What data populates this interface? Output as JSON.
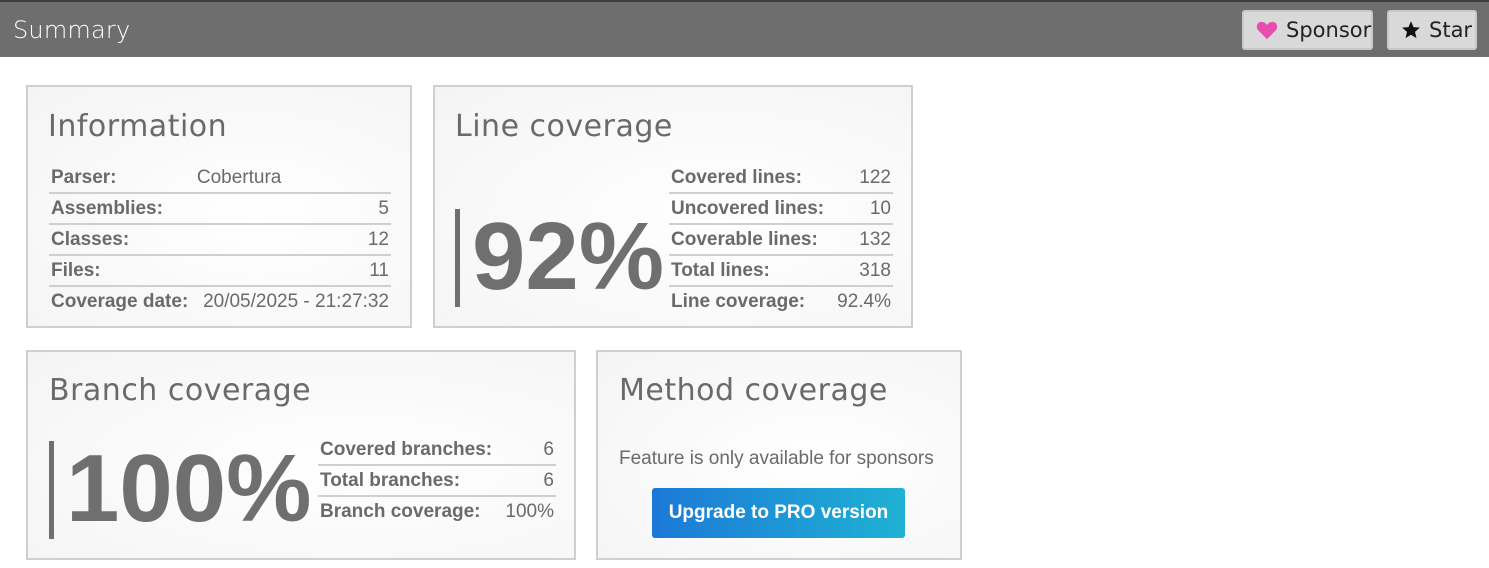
{
  "header": {
    "title": "Summary",
    "sponsor_label": "Sponsor",
    "star_label": "Star",
    "colors": {
      "bar": "#6e6e6e",
      "heart": "#e84eb0"
    }
  },
  "information": {
    "title": "Information",
    "rows": [
      {
        "label": "Parser:",
        "value": "Cobertura"
      },
      {
        "label": "Assemblies:",
        "value": "5"
      },
      {
        "label": "Classes:",
        "value": "12"
      },
      {
        "label": "Files:",
        "value": "11"
      },
      {
        "label": "Coverage date:",
        "value": "20/05/2025 - 21:27:32"
      }
    ]
  },
  "line_coverage": {
    "title": "Line coverage",
    "percent_text": "92%",
    "rows": [
      {
        "label": "Covered lines:",
        "value": "122"
      },
      {
        "label": "Uncovered lines:",
        "value": "10"
      },
      {
        "label": "Coverable lines:",
        "value": "132"
      },
      {
        "label": "Total lines:",
        "value": "318"
      },
      {
        "label": "Line coverage:",
        "value": "92.4%"
      }
    ]
  },
  "branch_coverage": {
    "title": "Branch coverage",
    "percent_text": "100%",
    "rows": [
      {
        "label": "Covered branches:",
        "value": "6"
      },
      {
        "label": "Total branches:",
        "value": "6"
      },
      {
        "label": "Branch coverage:",
        "value": "100%"
      }
    ]
  },
  "method_coverage": {
    "title": "Method coverage",
    "note": "Feature is only available for sponsors",
    "upgrade_label": "Upgrade to PRO version"
  }
}
